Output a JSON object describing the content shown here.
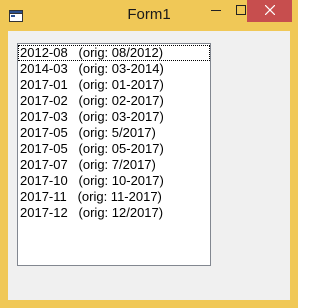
{
  "window": {
    "title": "Form1",
    "colors": {
      "frame": "#f0c857",
      "close_hover": "#c74e4e",
      "client": "#f0f0f0"
    },
    "icons": [
      "app-icon",
      "minimize-icon",
      "maximize-icon",
      "close-icon"
    ]
  },
  "listbox": {
    "items": [
      "2012-08   (orig: 08/2012)",
      "2014-03   (orig: 03-2014)",
      "2017-01   (orig: 01-2017)",
      "2017-02   (orig: 02-2017)",
      "2017-03   (orig: 03-2017)",
      "2017-05   (orig: 5/2017)",
      "2017-05   (orig: 05-2017)",
      "2017-07   (orig: 7/2017)",
      "2017-10   (orig: 10-2017)",
      "2017-11   (orig: 11-2017)",
      "2017-12   (orig: 12/2017)"
    ]
  }
}
